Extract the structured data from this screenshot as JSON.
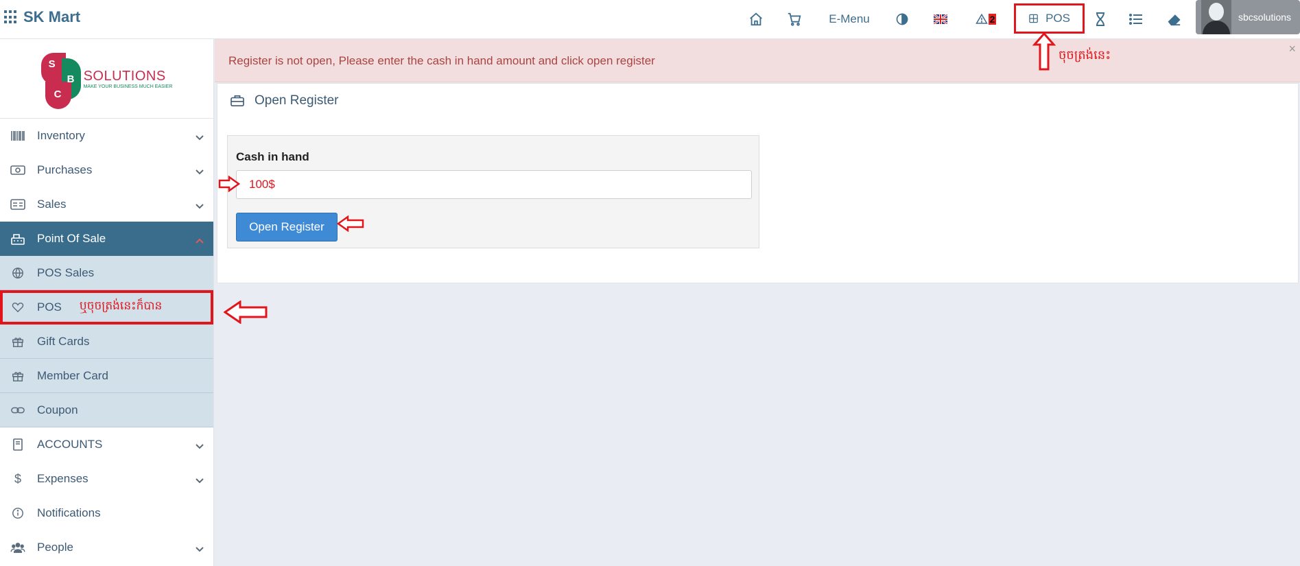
{
  "app": {
    "name": "SK Mart"
  },
  "topbar": {
    "emenu_label": "E-Menu",
    "alert_count": "2",
    "pos_label": "POS",
    "username": "sbcsolutions"
  },
  "logo": {
    "letters": [
      "S",
      "B",
      "C"
    ],
    "title": "SOLUTIONS",
    "tagline": "MAKE YOUR BUSINESS MUCH EASIER"
  },
  "sidebar": {
    "items": [
      {
        "label": "Inventory",
        "icon": "barcode-icon"
      },
      {
        "label": "Purchases",
        "icon": "money-icon"
      },
      {
        "label": "Sales",
        "icon": "id-card-icon"
      },
      {
        "label": "Point Of Sale",
        "icon": "cash-register-icon"
      },
      {
        "label": "POS Sales",
        "icon": "globe-icon"
      },
      {
        "label": "POS",
        "icon": "heart-icon"
      },
      {
        "label": "Gift Cards",
        "icon": "gift-icon"
      },
      {
        "label": "Member Card",
        "icon": "gift-icon"
      },
      {
        "label": "Coupon",
        "icon": "link-icon"
      },
      {
        "label": "ACCOUNTS",
        "icon": "book-icon"
      },
      {
        "label": "Expenses",
        "icon": "dollar-icon"
      },
      {
        "label": "Notifications",
        "icon": "info-icon"
      },
      {
        "label": "People",
        "icon": "users-icon"
      }
    ],
    "pos_note": "ឬចុចត្រង់នេះក៏បាន"
  },
  "alert": {
    "message": "Register is not open, Please enter the cash in hand amount and click open register",
    "close": "×"
  },
  "panel": {
    "title": "Open Register",
    "cash_label": "Cash in hand",
    "cash_value": "100$",
    "button": "Open Register"
  },
  "annotations": {
    "top_note": "ចុចត្រង់នេះ"
  },
  "colors": {
    "accent": "#3a6d8c",
    "alert_bg": "#f2dede",
    "annotation": "#e1161d",
    "button": "#3f8ad5"
  }
}
